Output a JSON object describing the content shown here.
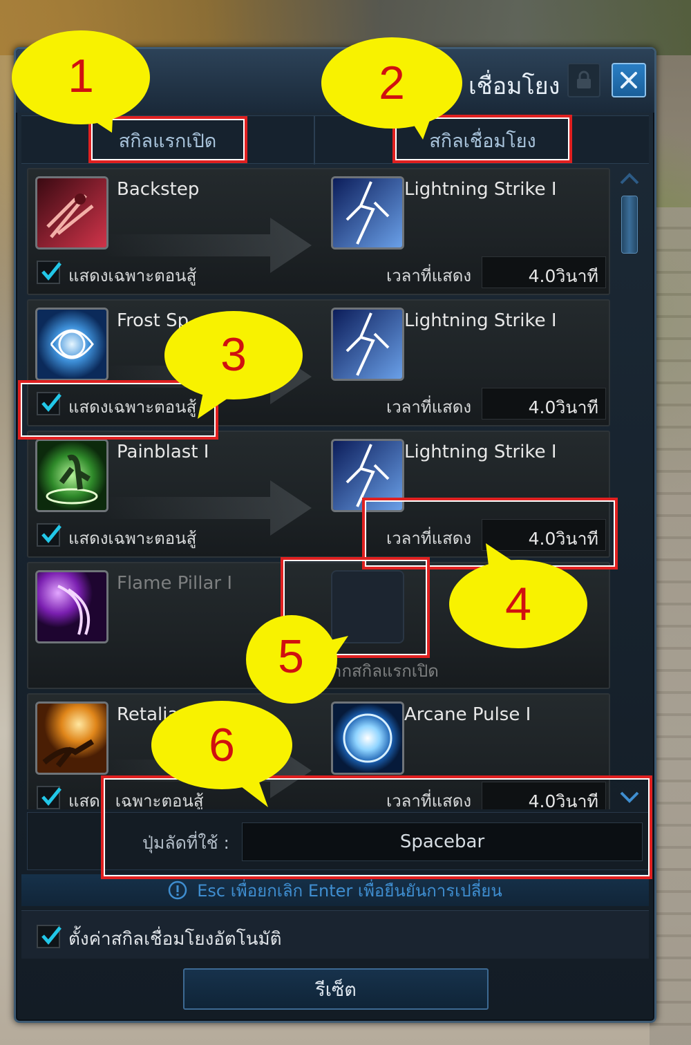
{
  "window": {
    "title": "เชื่อมโยง"
  },
  "tabs": [
    {
      "label": "สกิลแรกเปิด"
    },
    {
      "label": "สกิลเชื่อมโยง"
    }
  ],
  "rows": [
    {
      "source": {
        "name": "Backstep",
        "icon": "backstep-icon"
      },
      "target": {
        "name": "Lightning Strike I",
        "icon": "lightning-strike-icon"
      },
      "combat_only_label": "แสดงเฉพาะตอนสู้",
      "combat_only_checked": true,
      "time_label": "เวลาที่แสดง",
      "time_value": "4.0วินาที"
    },
    {
      "source": {
        "name": "Frost Sp",
        "icon": "frost-sphere-icon"
      },
      "target": {
        "name": "Lightning Strike I",
        "icon": "lightning-strike-icon"
      },
      "combat_only_label": "แสดงเฉพาะตอนสู้",
      "combat_only_checked": true,
      "time_label": "เวลาที่แสดง",
      "time_value": "4.0วินาที"
    },
    {
      "source": {
        "name": "Painblast I",
        "icon": "painblast-icon"
      },
      "target": {
        "name": "Lightning Strike I",
        "icon": "lightning-strike-icon"
      },
      "combat_only_label": "แสดงเฉพาะตอนสู้",
      "combat_only_checked": true,
      "time_label": "เวลาที่แสดง",
      "time_value": "4.0วินาที"
    },
    {
      "source": {
        "name": "Flame Pillar I",
        "icon": "flame-pillar-icon"
      },
      "target": null,
      "hint": "ากสกิลแรกเปิด"
    },
    {
      "source": {
        "name": "Retalia",
        "icon": "retaliation-icon"
      },
      "target": {
        "name": "Arcane Pulse I",
        "icon": "arcane-pulse-icon"
      },
      "combat_only_label": "แสด",
      "combat_only_label_tail": "เฉพาะตอนสู้",
      "combat_only_checked": true,
      "time_label": "เวลาที่แสดง",
      "time_value": "4.0วินาที"
    }
  ],
  "hotkey": {
    "label": "ปุ่มลัดที่ใช้ :",
    "value": "Spacebar"
  },
  "info": {
    "text": "Esc เพื่อยกเลิก Enter เพื่อยืนยันการเปลี่ยน"
  },
  "auto": {
    "label": "ตั้งค่าสกิลเชื่อมโยงอัตโนมัติ",
    "checked": true
  },
  "reset": {
    "label": "รีเซ็ต"
  },
  "annotations": [
    {
      "number": "1"
    },
    {
      "number": "2"
    },
    {
      "number": "3"
    },
    {
      "number": "4"
    },
    {
      "number": "5"
    },
    {
      "number": "6"
    }
  ],
  "colors": {
    "annotation_red": "#e02020",
    "bubble_yellow": "#f8f200",
    "accent_blue": "#2a7ec4",
    "check_cyan": "#22c7e8"
  }
}
